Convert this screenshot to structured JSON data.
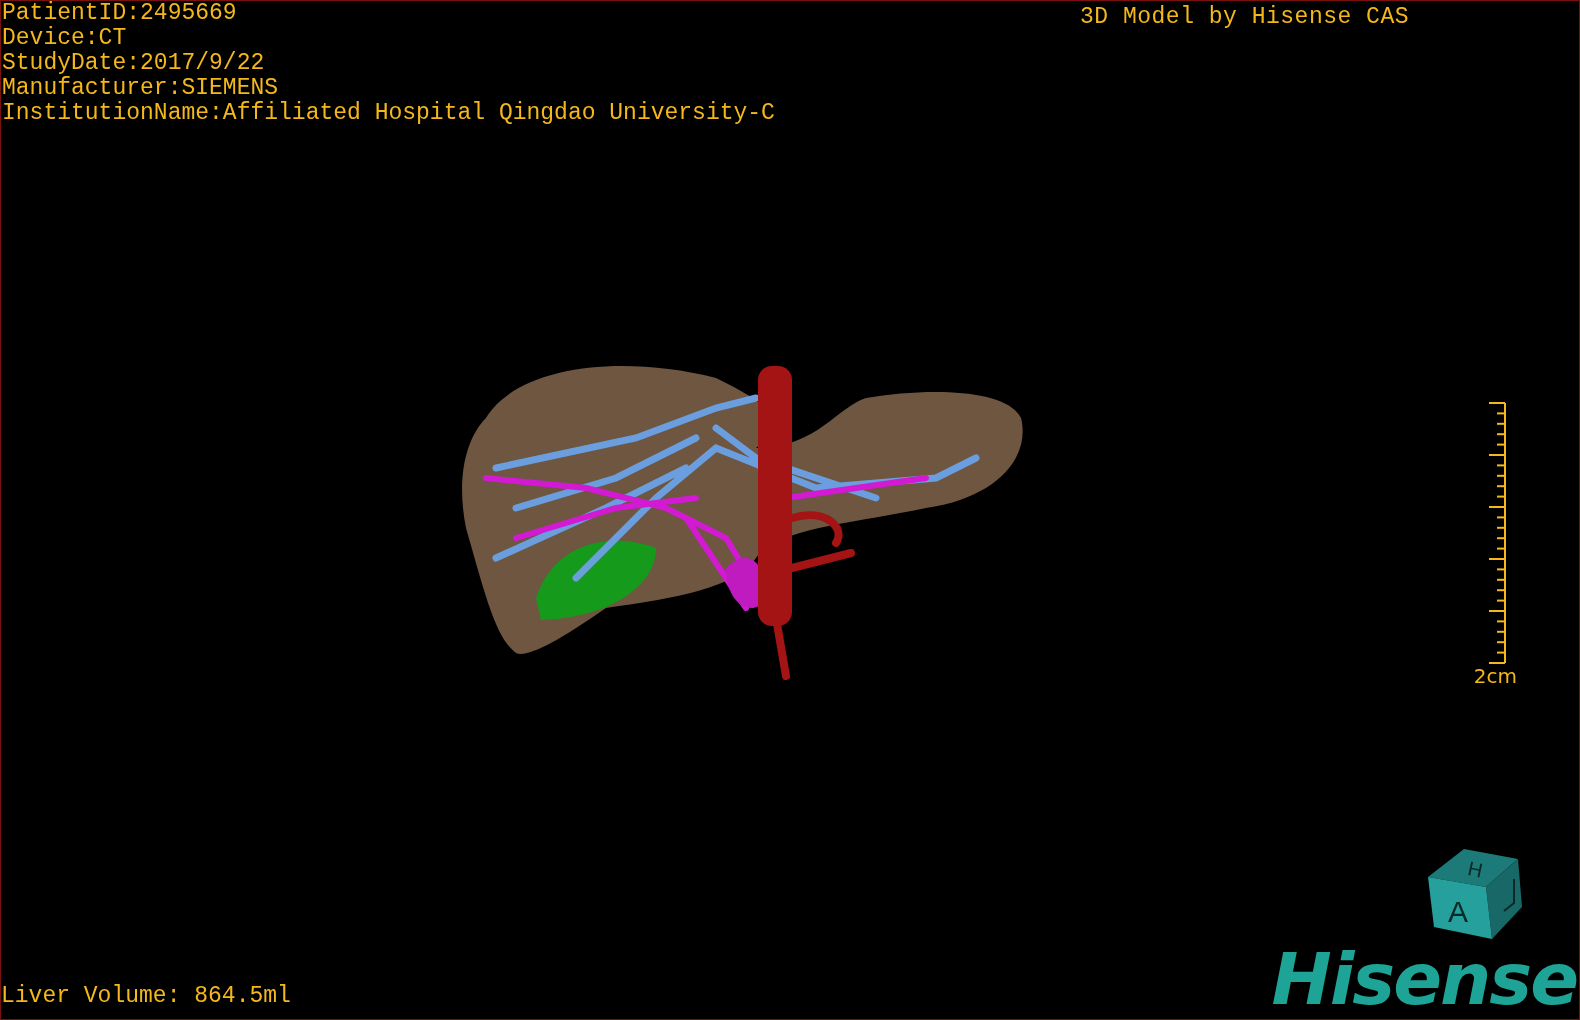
{
  "study_info": [
    "PatientID:2495669",
    "Device:CT",
    "StudyDate:2017/9/22",
    "Manufacturer:SIEMENS",
    "InstitutionName:Affiliated Hospital Qingdao University-C"
  ],
  "header_right": "3D Model by Hisense CAS",
  "scale_bar": {
    "label": "2cm"
  },
  "orientation_cube": {
    "top_label": "H",
    "front_label": "A"
  },
  "logo": "Hisense",
  "liver_volume": "Liver Volume: 864.5ml"
}
